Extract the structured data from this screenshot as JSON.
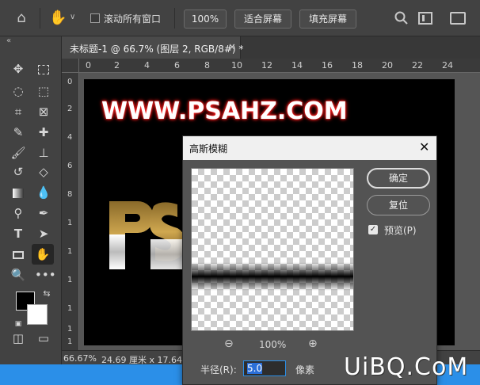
{
  "options_bar": {
    "scroll_all_label": "滚动所有窗口",
    "zoom_value": "100%",
    "fit_screen_label": "适合屏幕",
    "fill_screen_label": "填充屏幕"
  },
  "document_tab": {
    "title": "未标题-1 @ 66.7% (图层 2, RGB/8#) *",
    "close": "×"
  },
  "ruler": {
    "h_ticks": [
      "0",
      "2",
      "4",
      "6",
      "8",
      "10",
      "12",
      "14",
      "16",
      "18",
      "20",
      "22",
      "24"
    ],
    "v_ticks": [
      "0",
      "2",
      "4",
      "6",
      "8",
      "1",
      "1",
      "1",
      "1",
      "1",
      "1"
    ]
  },
  "canvas": {
    "headline": "WWW.PSAHZ.COM"
  },
  "status_bar": {
    "zoom": "66.67%",
    "size": "24.69 厘米 x 17.64 厘"
  },
  "dialog": {
    "title": "高斯模糊",
    "ok_label": "确定",
    "reset_label": "复位",
    "preview_label": "预览(P)",
    "preview_checked": true,
    "zoom_percent": "100%",
    "radius_label": "半径(R):",
    "radius_value": "5.0",
    "unit_label": "像素"
  },
  "watermark": "UiBQ.CoM",
  "colors": {
    "accent": "#2b8fe8",
    "foreground": "#000000",
    "background": "#ffffff",
    "headline_glow": "#ff2a2a"
  },
  "icons": [
    "home-icon",
    "hand-icon",
    "search-icon",
    "workspace-icon",
    "move-icon",
    "marquee-icon",
    "lasso-icon",
    "quick-select-icon",
    "crop-icon",
    "frame-icon",
    "eyedropper-icon",
    "healing-icon",
    "brush-icon",
    "stamp-icon",
    "history-brush-icon",
    "eraser-icon",
    "gradient-icon",
    "blur-icon",
    "dodge-icon",
    "pen-icon",
    "type-icon",
    "path-select-icon",
    "rectangle-icon",
    "zoom-icon",
    "more-icon",
    "zoom-out-icon",
    "zoom-in-icon"
  ]
}
